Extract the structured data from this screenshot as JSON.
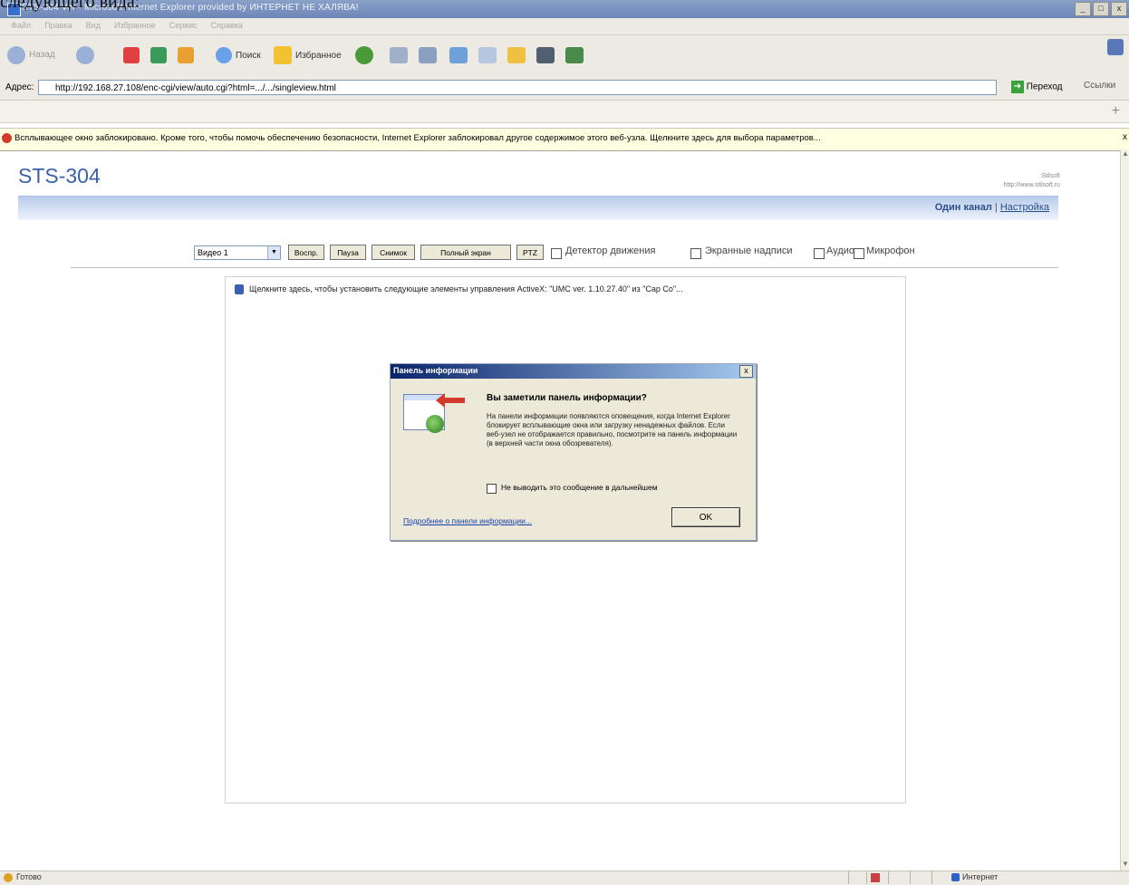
{
  "caption_text": "следующего вида:",
  "window": {
    "title": "STS-304 Ver - Microsoft Internet Explorer provided by ИНТЕРНЕТ НЕ ХАЛЯВА!",
    "controls": [
      "_",
      "□",
      "x"
    ]
  },
  "menu": [
    "Файл",
    "Правка",
    "Вид",
    "Избранное",
    "Сервис",
    "Справка"
  ],
  "toolbar": {
    "back": "Назад",
    "search": "Поиск",
    "favorites": "Избранное"
  },
  "address": {
    "label": "Адрес:",
    "url": "http://192.168.27.108/enc-cgi/view/auto.cgi?html=.../.../singleview.html",
    "go": "Переход",
    "links": "Ссылки"
  },
  "popup_bar": {
    "text": "Всплывающее окно заблокировано. Кроме того, чтобы помочь обеспечению безопасности, Internet Explorer заблокировал другое содержимое этого веб-узла. Щелкните здесь для выбора параметров...",
    "close": "x"
  },
  "page": {
    "logo": "STS-304",
    "brand_line1": "Stilsoft",
    "brand_line2": "http://www.stilsoft.ru",
    "nav_current": "Один канал",
    "nav_separator": "|",
    "nav_link": "Настройка"
  },
  "controls": {
    "video_select": "Видео 1",
    "buttons": [
      "Воспр.",
      "Пауза",
      "Снимок",
      "Полный экран",
      "PTZ"
    ],
    "checkboxes": [
      "Детектор движения",
      "Экранные надписи",
      "Аудио",
      "Микрофон"
    ]
  },
  "activex_bar": "Щелкните здесь, чтобы установить следующие элементы управления ActiveX: \"UMC ver. 1.10.27.40\" из \"Cap Co\"...",
  "dialog": {
    "title": "Панель информации",
    "heading": "Вы заметили панель информации?",
    "body": "На панели информации появляются оповещения, когда Internet Explorer блокирует всплывающие окна или загрузку ненадежных файлов. Если веб-узел не отображается правильно, посмотрите на панель информации (в верхней части окна обозревателя).",
    "checkbox": "Не выводить это сообщение в дальнейшем",
    "link": "Подробнее о панели информации...",
    "ok": "OK",
    "close": "x"
  },
  "status": {
    "text": "Готово",
    "zone": "Интернет"
  }
}
